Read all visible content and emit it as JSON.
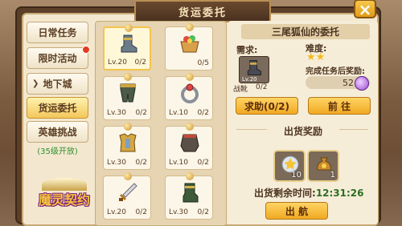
{
  "title": "货运委托",
  "close_symbol": "×",
  "tabs": [
    {
      "label": "日常任务"
    },
    {
      "label": "限时活动",
      "alert": true
    },
    {
      "label": "地下城",
      "arrow": "❯"
    },
    {
      "label": "货运委托",
      "active": true
    },
    {
      "label": "英雄挑战",
      "sub": "(35级开放)"
    }
  ],
  "logo_text": "魔灵契约",
  "cards": [
    {
      "item": "boot-icon",
      "lv": "Lv.20",
      "count": "0/2",
      "selected": true
    },
    {
      "item": "gift-basket-icon",
      "lv": "",
      "count": "0/5"
    },
    {
      "item": "leg-armor-icon",
      "lv": "Lv.30",
      "count": "0/2"
    },
    {
      "item": "ring-icon",
      "lv": "Lv.10",
      "count": "0/2"
    },
    {
      "item": "chest-armor-icon",
      "lv": "Lv.30",
      "count": "0/2"
    },
    {
      "item": "skirt-armor-icon",
      "lv": "Lv.10",
      "count": "0/2"
    },
    {
      "item": "sword-icon",
      "lv": "Lv.20",
      "count": "0/2"
    },
    {
      "item": "gauntlet-icon",
      "lv": "Lv.30",
      "count": "0/2"
    }
  ],
  "panel": {
    "heading": "三尾狐仙的委托",
    "need_label": "需求:",
    "req_lv": "Lv.20",
    "req_name": "战靴",
    "req_count": "0/2",
    "difficulty_label": "难度:",
    "difficulty_stars": "★★",
    "reward_label": "完成任务后奖励:",
    "reward_value": "52",
    "help_button": "求助(0/2)",
    "go_button": "前 往",
    "ship_reward_label": "出货奖励",
    "ship_rewards": [
      {
        "icon": "star-medal-icon",
        "count": "10"
      },
      {
        "icon": "gold-bag-icon",
        "count": "1"
      }
    ],
    "timer_label": "出货剩余时间:",
    "timer_value": "12:31:26",
    "ship_button": "出 航"
  }
}
